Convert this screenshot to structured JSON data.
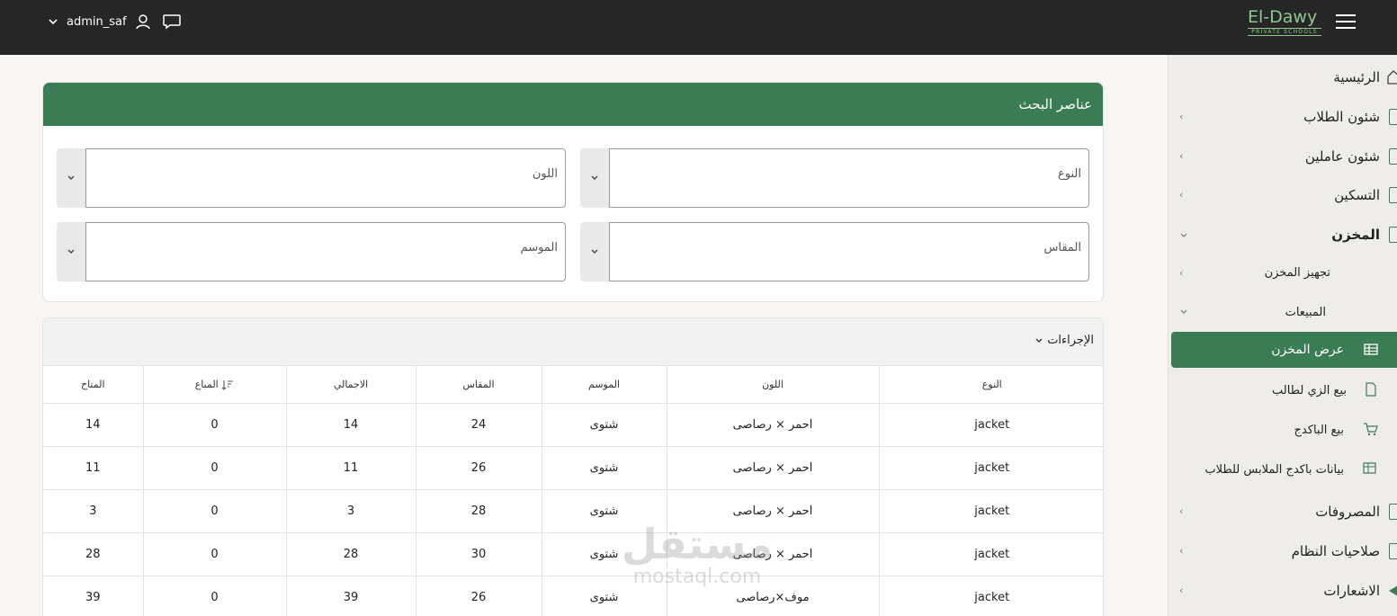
{
  "topbar": {
    "username": "admin_saf",
    "logo_text": "El-Dawy",
    "logo_sub": "PRIVATE SCHOOLS"
  },
  "sidebar": {
    "items": [
      {
        "label": "الرئيسية"
      },
      {
        "label": "شئون الطلاب"
      },
      {
        "label": "شئون عاملين"
      },
      {
        "label": "التسكين"
      },
      {
        "label": "المخزن"
      },
      {
        "label": "تجهيز المخزن"
      },
      {
        "label": "المبيعات"
      },
      {
        "label": "عرض المخزن"
      },
      {
        "label": "بيع الزي لطالب"
      },
      {
        "label": "بيع الباكدج"
      },
      {
        "label": "بيانات باكدج الملابس للطلاب"
      },
      {
        "label": "المصروفات"
      },
      {
        "label": "صلاحيات النظام"
      },
      {
        "label": "الاشعارات"
      }
    ]
  },
  "search": {
    "title": "عناصر البحث",
    "type_placeholder": "النوع",
    "color_placeholder": "اللون",
    "size_placeholder": "المقاس",
    "season_placeholder": "الموسم"
  },
  "table": {
    "actions_label": "الإجراءات",
    "headers": [
      "المتاح",
      "المباع",
      "الاجمالي",
      "المقاس",
      "الموسم",
      "اللون",
      "النوع"
    ],
    "rows": [
      [
        "14",
        "0",
        "14",
        "24",
        "شتوى",
        "احمر × رصاصى",
        "jacket"
      ],
      [
        "11",
        "0",
        "11",
        "26",
        "شتوى",
        "احمر × رصاصى",
        "jacket"
      ],
      [
        "3",
        "0",
        "3",
        "28",
        "شتوى",
        "احمر × رصاصى",
        "jacket"
      ],
      [
        "28",
        "0",
        "28",
        "30",
        "شتوى",
        "احمر × رصاصى",
        "jacket"
      ],
      [
        "39",
        "0",
        "39",
        "26",
        "شتوى",
        "موف×رصاصى",
        "jacket"
      ]
    ]
  },
  "watermark": {
    "arabic": "مستقل",
    "latin": "mostaql.com"
  },
  "colors": {
    "brand_green": "#3a7d55",
    "topbar": "#262626"
  }
}
